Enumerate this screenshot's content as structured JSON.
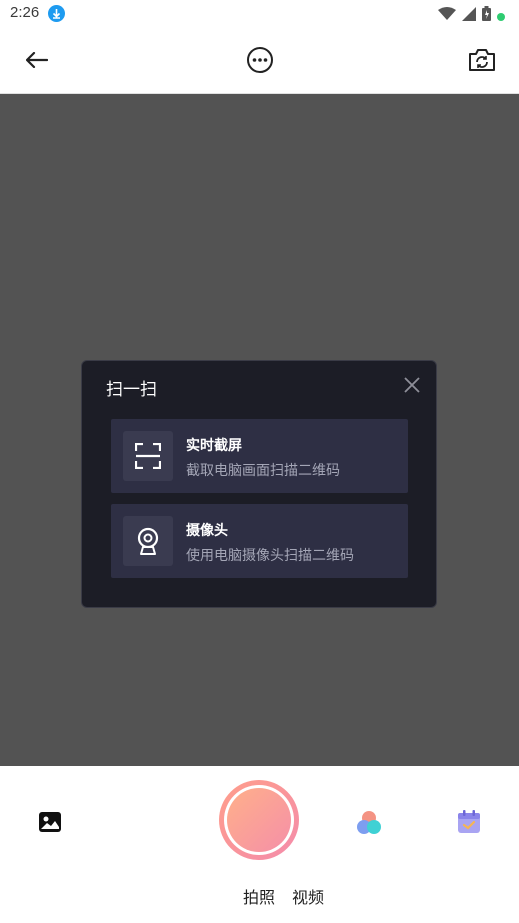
{
  "status_bar": {
    "time": "2:26"
  },
  "dialog": {
    "title": "扫一扫",
    "options": [
      {
        "title": "实时截屏",
        "subtitle": "截取电脑画面扫描二维码",
        "icon": "scan-frame-icon"
      },
      {
        "title": "摄像头",
        "subtitle": "使用电脑摄像头扫描二维码",
        "icon": "webcam-icon"
      }
    ]
  },
  "bottom": {
    "modes": [
      "拍照",
      "视频"
    ]
  },
  "colors": {
    "accent_gradient_start": "#ffb08a",
    "accent_gradient_end": "#f58fa8",
    "dialog_bg": "#1c1d26",
    "option_bg": "#2e2f44"
  }
}
